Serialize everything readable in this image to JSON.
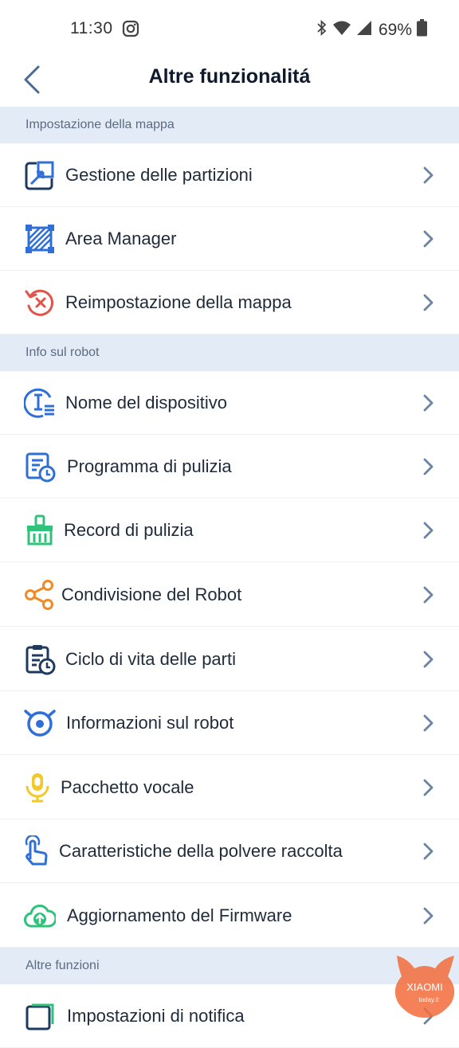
{
  "status_bar": {
    "time": "11:30",
    "battery": "69%"
  },
  "header": {
    "title": "Altre funzionalitá"
  },
  "sections": {
    "map": {
      "title": "Impostazione della mappa",
      "items": [
        {
          "label": "Gestione delle partizioni",
          "icon": "partition-icon",
          "color": "#1f3a5f"
        },
        {
          "label": "Area Manager",
          "icon": "area-icon",
          "color": "#2f6fd6"
        },
        {
          "label": "Reimpostazione della mappa",
          "icon": "reset-map-icon",
          "color": "#e0554a"
        }
      ]
    },
    "robot": {
      "title": "Info sul robot",
      "items": [
        {
          "label": "Nome del dispositivo",
          "icon": "device-name-icon",
          "color": "#2f6fd6"
        },
        {
          "label": "Programma di pulizia",
          "icon": "schedule-icon",
          "color": "#2f6fd6"
        },
        {
          "label": "Record di pulizia",
          "icon": "broom-icon",
          "color": "#2fc27a"
        },
        {
          "label": "Condivisione del Robot",
          "icon": "share-icon",
          "color": "#ef8a25"
        },
        {
          "label": "Ciclo di vita delle parti",
          "icon": "clipboard-clock-icon",
          "color": "#1f3a5f"
        },
        {
          "label": "Informazioni sul robot",
          "icon": "robot-info-icon",
          "color": "#2f6fd6"
        },
        {
          "label": "Pacchetto vocale",
          "icon": "microphone-icon",
          "color": "#f2c928"
        },
        {
          "label": "Caratteristiche della polvere raccolta",
          "icon": "touch-hand-icon",
          "color": "#2f6fd6"
        },
        {
          "label": "Aggiornamento del Firmware",
          "icon": "cloud-upload-icon",
          "color": "#2fc27a"
        }
      ]
    },
    "other": {
      "title": "Altre funzioni",
      "items": [
        {
          "label": "Impostazioni di notifica",
          "icon": "notification-icon",
          "color": "#1f3a5f"
        }
      ]
    }
  },
  "watermark": {
    "brand": "XIAOMI",
    "site": "today.it"
  },
  "colors": {
    "section_bg": "#e3ebf6",
    "chevron": "#6b84a3"
  }
}
